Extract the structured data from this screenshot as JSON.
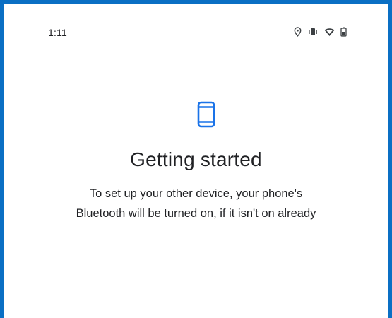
{
  "status_bar": {
    "time": "1:11",
    "icons": [
      "location-icon",
      "vibrate-icon",
      "wifi-icon",
      "battery-icon"
    ]
  },
  "main": {
    "icon": "phone-icon",
    "title": "Getting started",
    "subtitle_line1": "To set up your other device, your phone's",
    "subtitle_line2": "Bluetooth will be turned on, if it isn't on already"
  },
  "colors": {
    "frame_border": "#0a6fc4",
    "accent": "#1a73e8",
    "text": "#202124"
  }
}
